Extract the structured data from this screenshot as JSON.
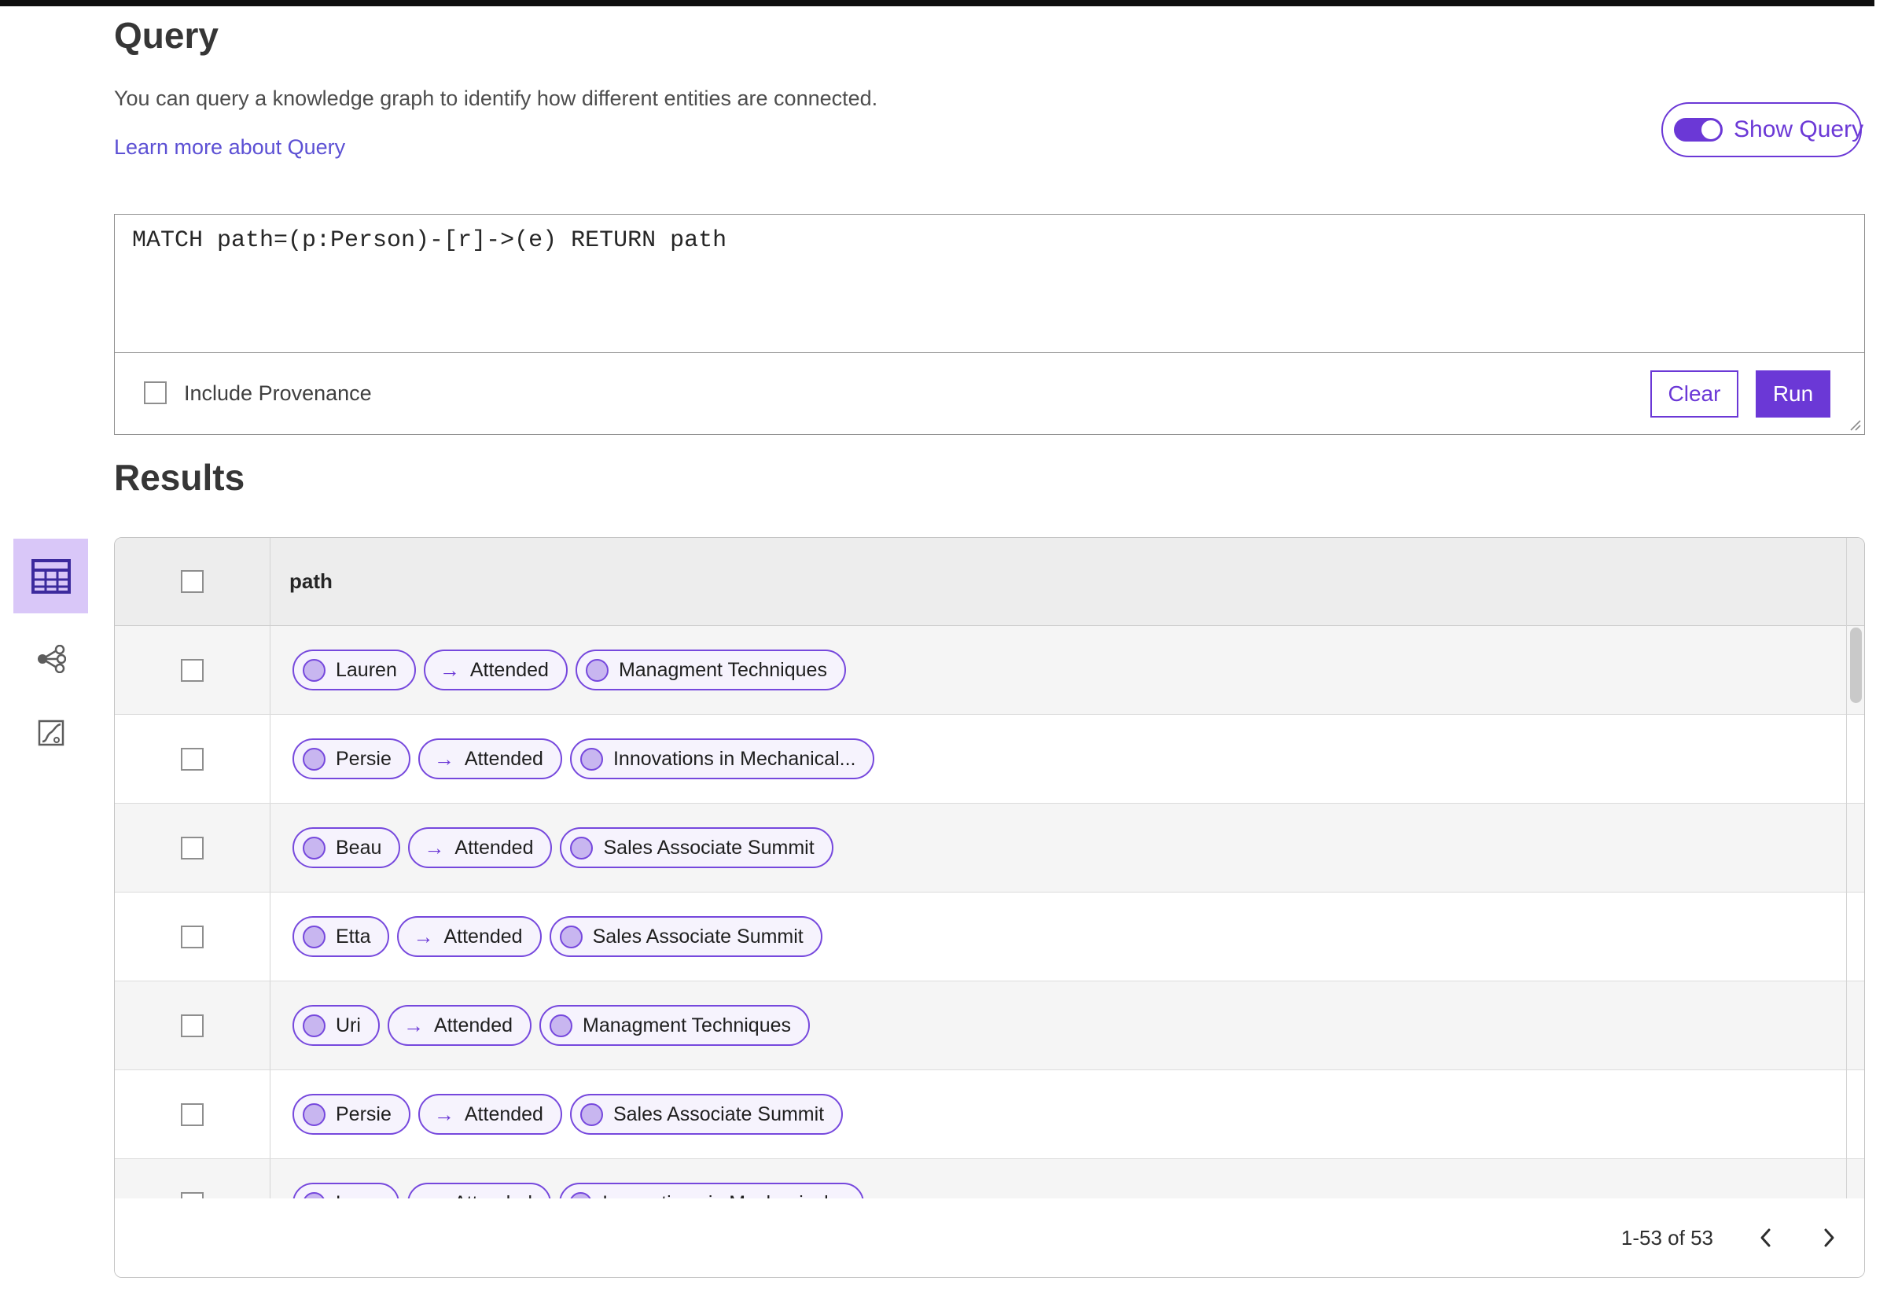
{
  "header": {
    "title": "Query",
    "description": "You can query a knowledge graph to identify how different entities are connected.",
    "learn_more_label": "Learn more about Query"
  },
  "toggle": {
    "label": "Show Query",
    "state": "on"
  },
  "query_editor": {
    "query_text": "MATCH path=(p:Person)-[r]->(e) RETURN path",
    "include_provenance_label": "Include Provenance",
    "include_provenance_checked": false,
    "clear_label": "Clear",
    "run_label": "Run"
  },
  "results": {
    "title": "Results",
    "column_header": "path",
    "arrow_glyph": "→",
    "view_switcher": [
      {
        "name": "table-view",
        "selected": true
      },
      {
        "name": "network-view",
        "selected": false
      },
      {
        "name": "chart-view",
        "selected": false
      }
    ],
    "rows": [
      {
        "source": "Lauren",
        "relation": "Attended",
        "target": "Managment Techniques"
      },
      {
        "source": "Persie",
        "relation": "Attended",
        "target": "Innovations in Mechanical..."
      },
      {
        "source": "Beau",
        "relation": "Attended",
        "target": "Sales Associate Summit"
      },
      {
        "source": "Etta",
        "relation": "Attended",
        "target": "Sales Associate Summit"
      },
      {
        "source": "Uri",
        "relation": "Attended",
        "target": "Managment Techniques"
      },
      {
        "source": "Persie",
        "relation": "Attended",
        "target": "Sales Associate Summit"
      },
      {
        "source": "Larry",
        "relation": "Attended",
        "target": "Innovations in Mechanical..."
      }
    ],
    "pagination": {
      "range_text": "1-53 of 53"
    }
  },
  "colors": {
    "primary_purple": "#6b38d6",
    "pill_border": "#7648dd",
    "node_fill": "#c8b6f0",
    "selected_view_bg": "#d9c7f8",
    "link": "#5c50d4",
    "header_row_bg": "#ededed",
    "alt_row_bg": "#f5f5f5"
  }
}
